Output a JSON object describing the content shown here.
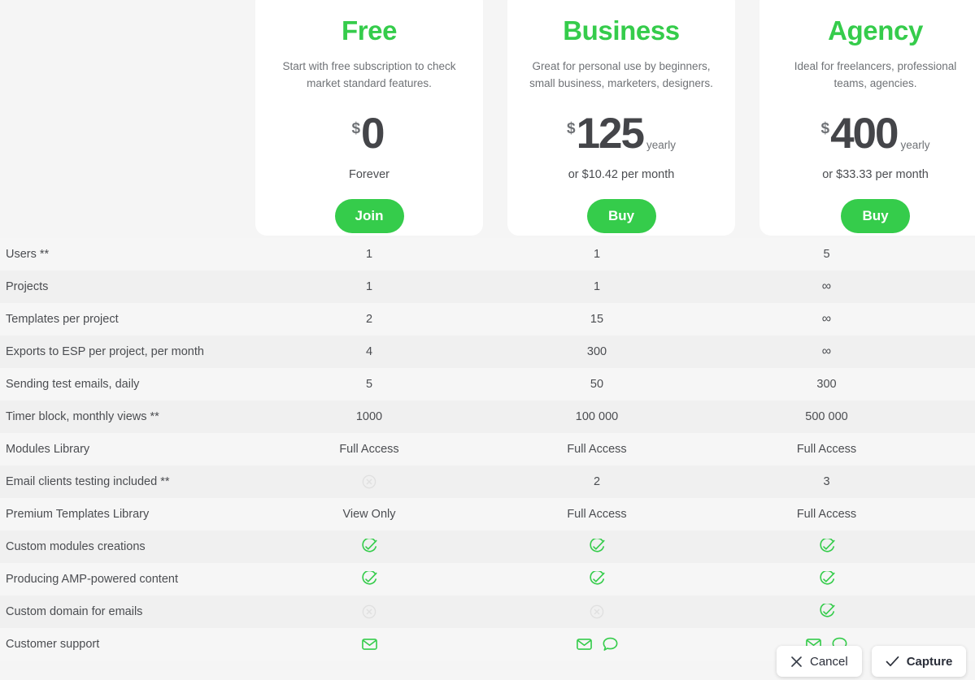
{
  "page": {
    "background": "#f5f5f5",
    "accent_green": "#35cc4b",
    "text_color": "#4b4d51"
  },
  "plans": [
    {
      "name": "Free",
      "description": "Start with free subscription to check market standard features.",
      "currency": "$",
      "amount": "0",
      "period": "",
      "note": "Forever",
      "cta_label": "Join"
    },
    {
      "name": "Business",
      "description": "Great for personal use by beginners, small business, marketers, designers.",
      "currency": "$",
      "amount": "125",
      "period": "yearly",
      "note": "or $10.42 per month",
      "cta_label": "Buy"
    },
    {
      "name": "Agency",
      "description": "Ideal for freelancers, professional teams, agencies.",
      "currency": "$",
      "amount": "400",
      "period": "yearly",
      "note": "or $33.33 per month",
      "cta_label": "Buy"
    }
  ],
  "features": [
    {
      "label": "Users **",
      "free": {
        "type": "text",
        "value": "1"
      },
      "business": {
        "type": "text",
        "value": "1"
      },
      "agency": {
        "type": "text",
        "value": "5"
      }
    },
    {
      "label": "Projects",
      "free": {
        "type": "text",
        "value": "1"
      },
      "business": {
        "type": "text",
        "value": "1"
      },
      "agency": {
        "type": "text",
        "value": "∞"
      }
    },
    {
      "label": "Templates per project",
      "free": {
        "type": "text",
        "value": "2"
      },
      "business": {
        "type": "text",
        "value": "15"
      },
      "agency": {
        "type": "text",
        "value": "∞"
      }
    },
    {
      "label": "Exports to ESP per project, per month",
      "free": {
        "type": "text",
        "value": "4"
      },
      "business": {
        "type": "text",
        "value": "300"
      },
      "agency": {
        "type": "text",
        "value": "∞"
      }
    },
    {
      "label": "Sending test emails, daily",
      "free": {
        "type": "text",
        "value": "5"
      },
      "business": {
        "type": "text",
        "value": "50"
      },
      "agency": {
        "type": "text",
        "value": "300"
      }
    },
    {
      "label": "Timer block, monthly views **",
      "free": {
        "type": "text",
        "value": "1000"
      },
      "business": {
        "type": "text",
        "value": "100 000"
      },
      "agency": {
        "type": "text",
        "value": "500 000"
      }
    },
    {
      "label": "Modules Library",
      "free": {
        "type": "text",
        "value": "Full Access"
      },
      "business": {
        "type": "text",
        "value": "Full Access"
      },
      "agency": {
        "type": "text",
        "value": "Full Access"
      }
    },
    {
      "label": "Email clients testing included **",
      "free": {
        "type": "icons",
        "icons": [
          "cross-circle-icon"
        ]
      },
      "business": {
        "type": "text",
        "value": "2"
      },
      "agency": {
        "type": "text",
        "value": "3"
      }
    },
    {
      "label": "Premium Templates Library",
      "free": {
        "type": "text",
        "value": "View Only"
      },
      "business": {
        "type": "text",
        "value": "Full Access"
      },
      "agency": {
        "type": "text",
        "value": "Full Access"
      }
    },
    {
      "label": "Custom modules creations",
      "free": {
        "type": "icons",
        "icons": [
          "check-circle-icon"
        ]
      },
      "business": {
        "type": "icons",
        "icons": [
          "check-circle-icon"
        ]
      },
      "agency": {
        "type": "icons",
        "icons": [
          "check-circle-icon"
        ]
      }
    },
    {
      "label": "Producing AMP-powered content",
      "free": {
        "type": "icons",
        "icons": [
          "check-circle-icon"
        ]
      },
      "business": {
        "type": "icons",
        "icons": [
          "check-circle-icon"
        ]
      },
      "agency": {
        "type": "icons",
        "icons": [
          "check-circle-icon"
        ]
      }
    },
    {
      "label": "Custom domain for emails",
      "free": {
        "type": "icons",
        "icons": [
          "cross-circle-icon"
        ]
      },
      "business": {
        "type": "icons",
        "icons": [
          "cross-circle-icon"
        ]
      },
      "agency": {
        "type": "icons",
        "icons": [
          "check-circle-icon"
        ]
      }
    },
    {
      "label": "Customer support",
      "free": {
        "type": "icons",
        "icons": [
          "envelope-icon"
        ]
      },
      "business": {
        "type": "icons",
        "icons": [
          "envelope-icon",
          "chat-bubble-icon"
        ]
      },
      "agency": {
        "type": "icons",
        "icons": [
          "envelope-icon",
          "chat-bubble-icon"
        ]
      }
    }
  ],
  "capture_overlay": {
    "cancel_label": "Cancel",
    "capture_label": "Capture"
  }
}
